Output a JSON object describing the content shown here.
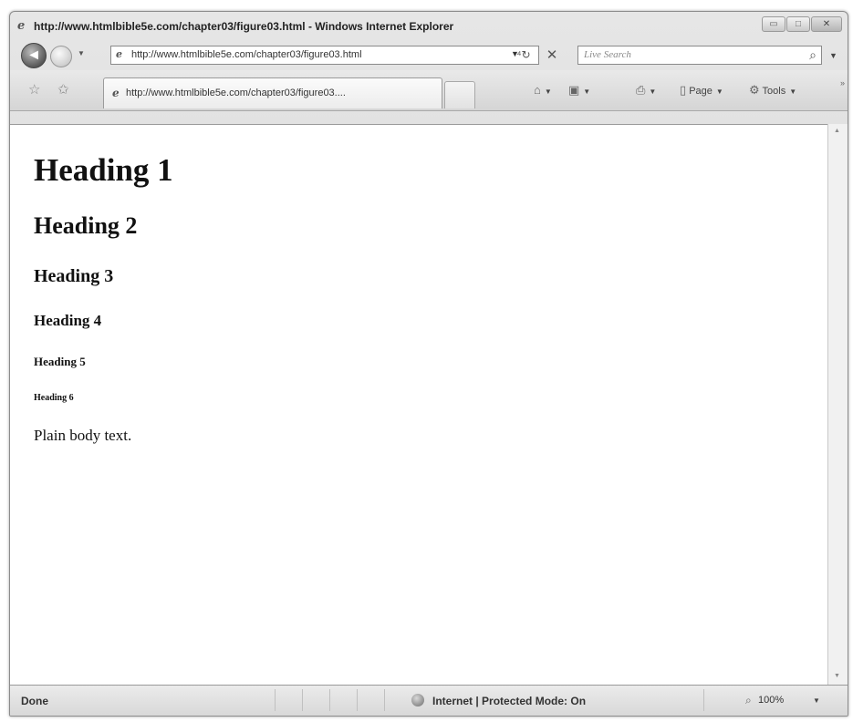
{
  "window": {
    "title": "http://www.htmlbible5e.com/chapter03/figure03.html - Windows Internet Explorer",
    "buttons": {
      "minimize": "▭",
      "maximize": "□",
      "close": "✕"
    }
  },
  "toolbar": {
    "address": "http://www.htmlbible5e.com/chapter03/figure03.html",
    "search_placeholder": "Live Search"
  },
  "tab": {
    "title": "http://www.htmlbible5e.com/chapter03/figure03...."
  },
  "commands": {
    "page_label": "Page",
    "tools_label": "Tools"
  },
  "page": {
    "h1": "Heading 1",
    "h2": "Heading 2",
    "h3": "Heading 3",
    "h4": "Heading 4",
    "h5": "Heading 5",
    "h6": "Heading 6",
    "body_text": "Plain body text."
  },
  "status": {
    "left": "Done",
    "zone": "Internet | Protected Mode: On",
    "zoom": "100%"
  },
  "icons": {
    "back": "back-arrow-icon",
    "forward": "forward-arrow-icon",
    "refresh": "refresh-icon",
    "stop": "stop-icon",
    "search": "search-icon",
    "favorites": "star-icon",
    "add_favorite": "add-favorite-icon",
    "home": "home-icon",
    "feeds": "feeds-icon",
    "print": "print-icon",
    "globe": "globe-icon",
    "zoom": "magnifier-icon"
  }
}
